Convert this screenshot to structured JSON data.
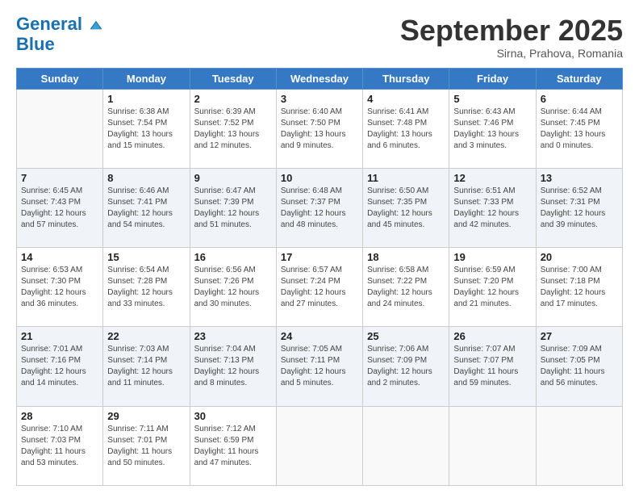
{
  "header": {
    "logo_line1": "General",
    "logo_line2": "Blue",
    "month": "September 2025",
    "location": "Sirna, Prahova, Romania"
  },
  "weekdays": [
    "Sunday",
    "Monday",
    "Tuesday",
    "Wednesday",
    "Thursday",
    "Friday",
    "Saturday"
  ],
  "weeks": [
    [
      {
        "day": "",
        "sunrise": "",
        "sunset": "",
        "daylight": ""
      },
      {
        "day": "1",
        "sunrise": "Sunrise: 6:38 AM",
        "sunset": "Sunset: 7:54 PM",
        "daylight": "Daylight: 13 hours and 15 minutes."
      },
      {
        "day": "2",
        "sunrise": "Sunrise: 6:39 AM",
        "sunset": "Sunset: 7:52 PM",
        "daylight": "Daylight: 13 hours and 12 minutes."
      },
      {
        "day": "3",
        "sunrise": "Sunrise: 6:40 AM",
        "sunset": "Sunset: 7:50 PM",
        "daylight": "Daylight: 13 hours and 9 minutes."
      },
      {
        "day": "4",
        "sunrise": "Sunrise: 6:41 AM",
        "sunset": "Sunset: 7:48 PM",
        "daylight": "Daylight: 13 hours and 6 minutes."
      },
      {
        "day": "5",
        "sunrise": "Sunrise: 6:43 AM",
        "sunset": "Sunset: 7:46 PM",
        "daylight": "Daylight: 13 hours and 3 minutes."
      },
      {
        "day": "6",
        "sunrise": "Sunrise: 6:44 AM",
        "sunset": "Sunset: 7:45 PM",
        "daylight": "Daylight: 13 hours and 0 minutes."
      }
    ],
    [
      {
        "day": "7",
        "sunrise": "Sunrise: 6:45 AM",
        "sunset": "Sunset: 7:43 PM",
        "daylight": "Daylight: 12 hours and 57 minutes."
      },
      {
        "day": "8",
        "sunrise": "Sunrise: 6:46 AM",
        "sunset": "Sunset: 7:41 PM",
        "daylight": "Daylight: 12 hours and 54 minutes."
      },
      {
        "day": "9",
        "sunrise": "Sunrise: 6:47 AM",
        "sunset": "Sunset: 7:39 PM",
        "daylight": "Daylight: 12 hours and 51 minutes."
      },
      {
        "day": "10",
        "sunrise": "Sunrise: 6:48 AM",
        "sunset": "Sunset: 7:37 PM",
        "daylight": "Daylight: 12 hours and 48 minutes."
      },
      {
        "day": "11",
        "sunrise": "Sunrise: 6:50 AM",
        "sunset": "Sunset: 7:35 PM",
        "daylight": "Daylight: 12 hours and 45 minutes."
      },
      {
        "day": "12",
        "sunrise": "Sunrise: 6:51 AM",
        "sunset": "Sunset: 7:33 PM",
        "daylight": "Daylight: 12 hours and 42 minutes."
      },
      {
        "day": "13",
        "sunrise": "Sunrise: 6:52 AM",
        "sunset": "Sunset: 7:31 PM",
        "daylight": "Daylight: 12 hours and 39 minutes."
      }
    ],
    [
      {
        "day": "14",
        "sunrise": "Sunrise: 6:53 AM",
        "sunset": "Sunset: 7:30 PM",
        "daylight": "Daylight: 12 hours and 36 minutes."
      },
      {
        "day": "15",
        "sunrise": "Sunrise: 6:54 AM",
        "sunset": "Sunset: 7:28 PM",
        "daylight": "Daylight: 12 hours and 33 minutes."
      },
      {
        "day": "16",
        "sunrise": "Sunrise: 6:56 AM",
        "sunset": "Sunset: 7:26 PM",
        "daylight": "Daylight: 12 hours and 30 minutes."
      },
      {
        "day": "17",
        "sunrise": "Sunrise: 6:57 AM",
        "sunset": "Sunset: 7:24 PM",
        "daylight": "Daylight: 12 hours and 27 minutes."
      },
      {
        "day": "18",
        "sunrise": "Sunrise: 6:58 AM",
        "sunset": "Sunset: 7:22 PM",
        "daylight": "Daylight: 12 hours and 24 minutes."
      },
      {
        "day": "19",
        "sunrise": "Sunrise: 6:59 AM",
        "sunset": "Sunset: 7:20 PM",
        "daylight": "Daylight: 12 hours and 21 minutes."
      },
      {
        "day": "20",
        "sunrise": "Sunrise: 7:00 AM",
        "sunset": "Sunset: 7:18 PM",
        "daylight": "Daylight: 12 hours and 17 minutes."
      }
    ],
    [
      {
        "day": "21",
        "sunrise": "Sunrise: 7:01 AM",
        "sunset": "Sunset: 7:16 PM",
        "daylight": "Daylight: 12 hours and 14 minutes."
      },
      {
        "day": "22",
        "sunrise": "Sunrise: 7:03 AM",
        "sunset": "Sunset: 7:14 PM",
        "daylight": "Daylight: 12 hours and 11 minutes."
      },
      {
        "day": "23",
        "sunrise": "Sunrise: 7:04 AM",
        "sunset": "Sunset: 7:13 PM",
        "daylight": "Daylight: 12 hours and 8 minutes."
      },
      {
        "day": "24",
        "sunrise": "Sunrise: 7:05 AM",
        "sunset": "Sunset: 7:11 PM",
        "daylight": "Daylight: 12 hours and 5 minutes."
      },
      {
        "day": "25",
        "sunrise": "Sunrise: 7:06 AM",
        "sunset": "Sunset: 7:09 PM",
        "daylight": "Daylight: 12 hours and 2 minutes."
      },
      {
        "day": "26",
        "sunrise": "Sunrise: 7:07 AM",
        "sunset": "Sunset: 7:07 PM",
        "daylight": "Daylight: 11 hours and 59 minutes."
      },
      {
        "day": "27",
        "sunrise": "Sunrise: 7:09 AM",
        "sunset": "Sunset: 7:05 PM",
        "daylight": "Daylight: 11 hours and 56 minutes."
      }
    ],
    [
      {
        "day": "28",
        "sunrise": "Sunrise: 7:10 AM",
        "sunset": "Sunset: 7:03 PM",
        "daylight": "Daylight: 11 hours and 53 minutes."
      },
      {
        "day": "29",
        "sunrise": "Sunrise: 7:11 AM",
        "sunset": "Sunset: 7:01 PM",
        "daylight": "Daylight: 11 hours and 50 minutes."
      },
      {
        "day": "30",
        "sunrise": "Sunrise: 7:12 AM",
        "sunset": "Sunset: 6:59 PM",
        "daylight": "Daylight: 11 hours and 47 minutes."
      },
      {
        "day": "",
        "sunrise": "",
        "sunset": "",
        "daylight": ""
      },
      {
        "day": "",
        "sunrise": "",
        "sunset": "",
        "daylight": ""
      },
      {
        "day": "",
        "sunrise": "",
        "sunset": "",
        "daylight": ""
      },
      {
        "day": "",
        "sunrise": "",
        "sunset": "",
        "daylight": ""
      }
    ]
  ]
}
